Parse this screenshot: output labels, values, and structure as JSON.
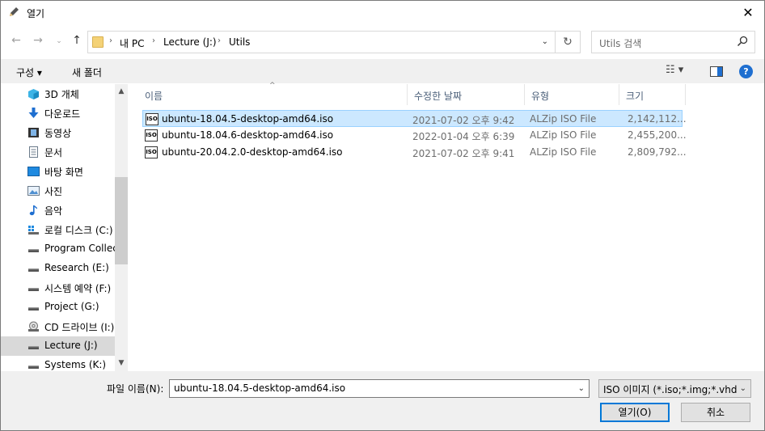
{
  "window": {
    "title": "열기"
  },
  "address": {
    "crumbs": [
      "내 PC",
      "Lecture (J:)",
      "Utils"
    ]
  },
  "search": {
    "placeholder": "Utils 검색"
  },
  "toolbar": {
    "organize": "구성 ▾",
    "new_folder": "새 폴더"
  },
  "sidebar": {
    "items": [
      {
        "label": "3D 개체",
        "icon": "cube-3d-icon"
      },
      {
        "label": "다운로드",
        "icon": "download-arrow-icon"
      },
      {
        "label": "동영상",
        "icon": "video-icon"
      },
      {
        "label": "문서",
        "icon": "document-icon"
      },
      {
        "label": "바탕 화면",
        "icon": "desktop-icon"
      },
      {
        "label": "사진",
        "icon": "picture-icon"
      },
      {
        "label": "음악",
        "icon": "music-note-icon"
      },
      {
        "label": "로컬 디스크 (C:)",
        "icon": "windows-drive-icon"
      },
      {
        "label": "Program Collect",
        "icon": "drive-icon"
      },
      {
        "label": "Research (E:)",
        "icon": "drive-icon"
      },
      {
        "label": "시스템 예약 (F:)",
        "icon": "drive-icon"
      },
      {
        "label": "Project (G:)",
        "icon": "drive-icon"
      },
      {
        "label": "CD 드라이브 (I:)",
        "icon": "cd-drive-icon"
      },
      {
        "label": "Lecture (J:)",
        "icon": "drive-icon",
        "selected": true
      },
      {
        "label": "Systems (K:)",
        "icon": "drive-icon"
      }
    ]
  },
  "columns": [
    "이름",
    "수정한 날짜",
    "유형",
    "크기"
  ],
  "files": [
    {
      "name": "ubuntu-18.04.5-desktop-amd64.iso",
      "date": "2021-07-02 오후 9:42",
      "type": "ALZip ISO File",
      "size": "2,142,112...",
      "selected": true
    },
    {
      "name": "ubuntu-18.04.6-desktop-amd64.iso",
      "date": "2022-01-04 오후 6:39",
      "type": "ALZip ISO File",
      "size": "2,455,200..."
    },
    {
      "name": "ubuntu-20.04.2.0-desktop-amd64.iso",
      "date": "2021-07-02 오후 9:41",
      "type": "ALZip ISO File",
      "size": "2,809,792..."
    }
  ],
  "file_icon_text": "ISO",
  "bottom": {
    "filename_label": "파일 이름(N):",
    "filename_value": "ubuntu-18.04.5-desktop-amd64.iso",
    "filetype_value": "ISO 이미지 (*.iso;*.img;*.vhd;*.",
    "open_label": "열기(O)",
    "cancel_label": "취소"
  },
  "colors": {
    "selection": "#cce8ff",
    "selection_border": "#99d1ff",
    "accent": "#0078d7"
  }
}
